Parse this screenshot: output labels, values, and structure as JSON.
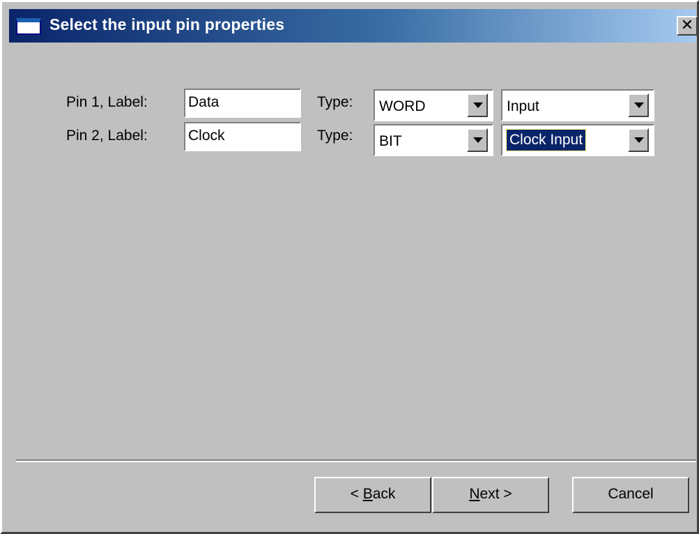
{
  "window": {
    "title": "Select the input pin properties",
    "close_glyph": "✕"
  },
  "pins": [
    {
      "label_text": "Pin 1, Label:",
      "label_value": "Data",
      "type_text": "Type:",
      "type_value": "WORD",
      "direction_value": "Input",
      "direction_selected": false
    },
    {
      "label_text": "Pin 2, Label:",
      "label_value": "Clock",
      "type_text": "Type:",
      "type_value": "BIT",
      "direction_value": "Clock Input",
      "direction_selected": true
    }
  ],
  "buttons": {
    "back_prefix": "< ",
    "back_mnemonic": "B",
    "back_rest": "ack",
    "next_mnemonic": "N",
    "next_rest": "ext >",
    "cancel_label": "Cancel"
  },
  "colors": {
    "face": "#c0c0c0",
    "title_bar": "#0a246a",
    "selection": "#0a246a"
  },
  "icons": {
    "title_icon": "window-icon",
    "close_icon": "close-icon",
    "dropdown_icon": "chevron-down-icon"
  }
}
